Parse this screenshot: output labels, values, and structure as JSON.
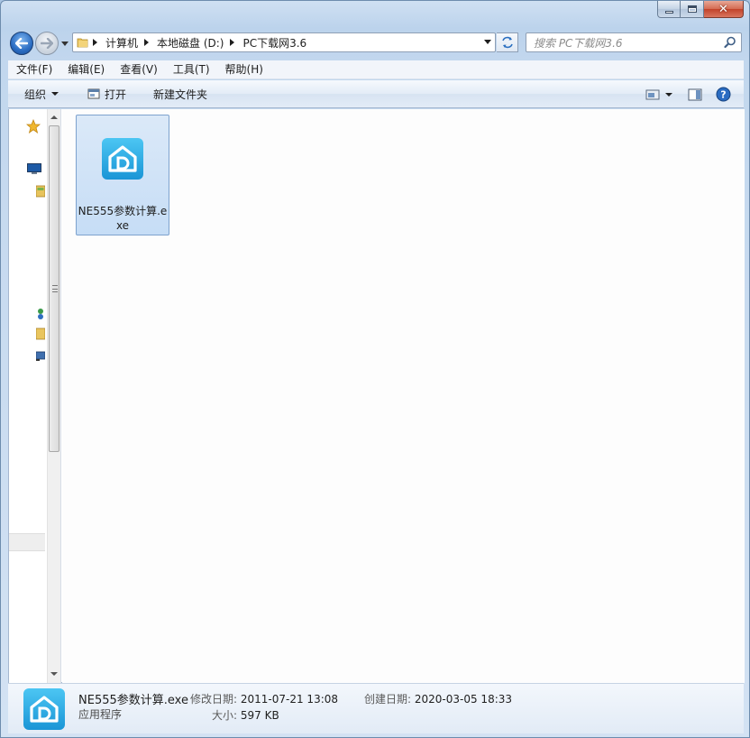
{
  "window": {
    "caption": {
      "minimize": "minimize",
      "maximize": "maximize",
      "close": "close"
    }
  },
  "address": {
    "crumbs": [
      "计算机",
      "本地磁盘 (D:)",
      "PC下载网3.6"
    ]
  },
  "search": {
    "placeholder": "搜索 PC下载网3.6"
  },
  "menubar": {
    "items": [
      "文件(F)",
      "编辑(E)",
      "查看(V)",
      "工具(T)",
      "帮助(H)"
    ]
  },
  "toolbar": {
    "organize": "组织",
    "open": "打开",
    "new_folder": "新建文件夹"
  },
  "files": [
    {
      "name": "NE555参数计算.exe",
      "selected": true
    }
  ],
  "details": {
    "name": "NE555参数计算.exe",
    "type": "应用程序",
    "modified_label": "修改日期:",
    "modified_value": "2011-07-21 13:08",
    "created_label": "创建日期:",
    "created_value": "2020-03-05 18:33",
    "size_label": "大小:",
    "size_value": "597 KB"
  },
  "colors": {
    "accent": "#3399ff",
    "selection_bg": "#cce8ff",
    "app_icon": "#2aa5e0"
  },
  "icons": {
    "app": "app-d-house-icon",
    "favorites": "star-icon",
    "desktop": "desktop-icon",
    "libraries": "library-icon",
    "network": "network-icon"
  }
}
